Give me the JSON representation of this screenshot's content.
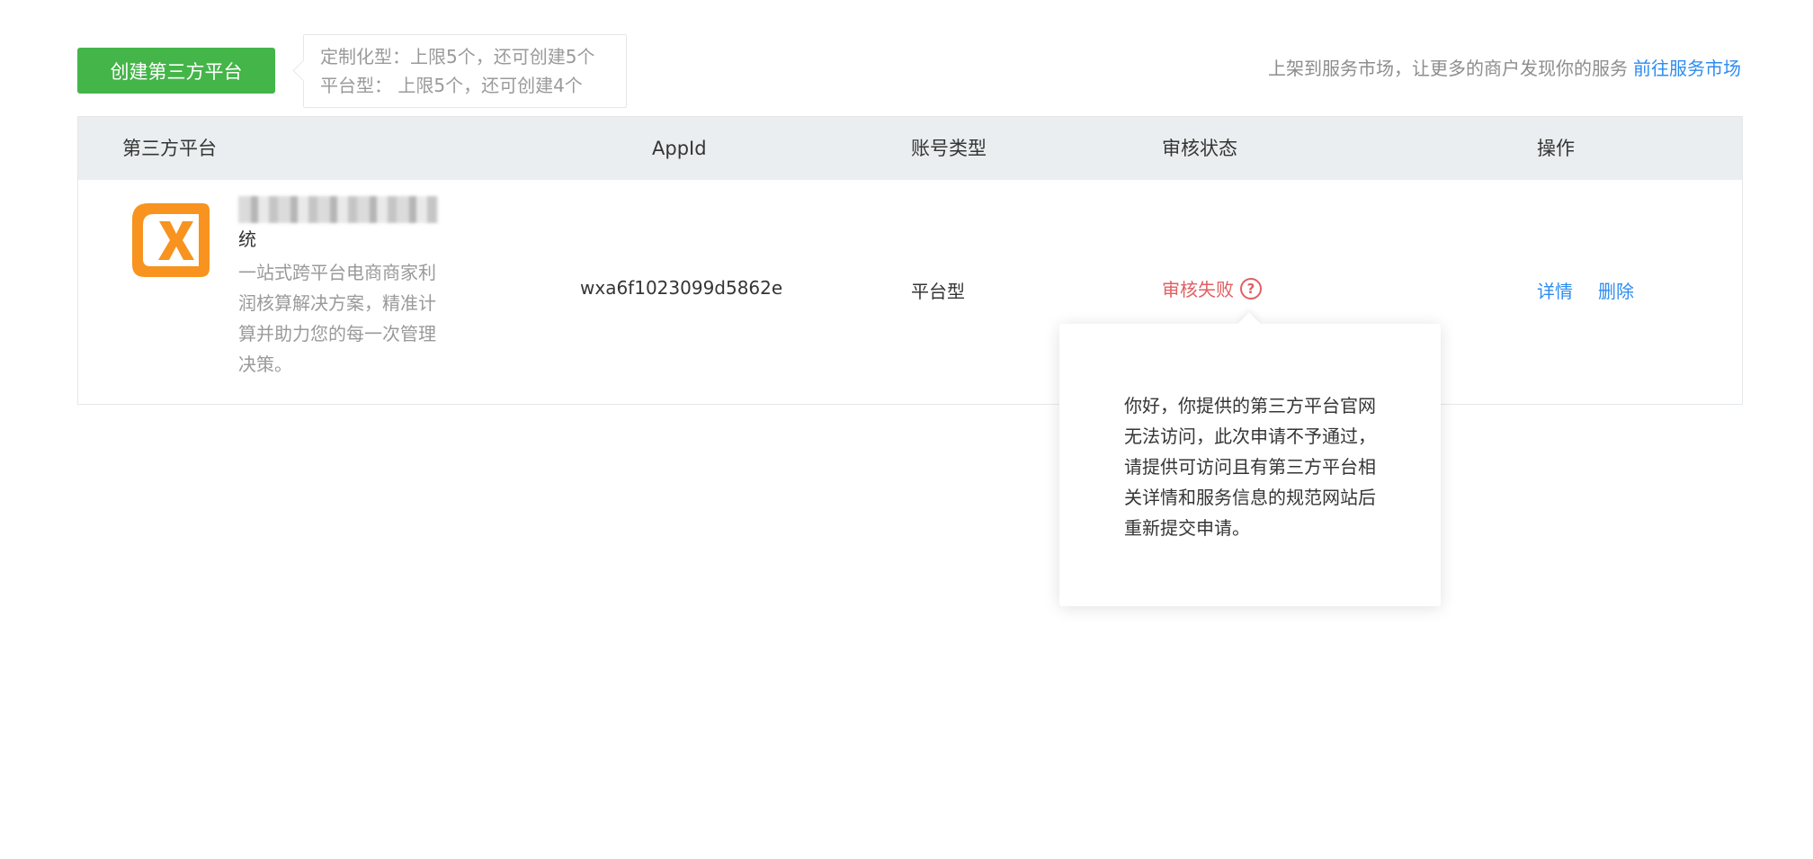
{
  "toolbar": {
    "create_button": "创建第三方平台",
    "quota_custom": "定制化型：上限5个，还可创建5个",
    "quota_platform": "平台型： 上限5个，还可创建4个",
    "market_tip": "上架到服务市场，让更多的商户发现你的服务",
    "market_link": "前往服务市场"
  },
  "table": {
    "headers": {
      "platform": "第三方平台",
      "appid": "AppId",
      "type": "账号类型",
      "status": "审核状态",
      "op": "操作"
    },
    "rows": [
      {
        "name_tail": "统",
        "description": "一站式跨平台电商商家利润核算解决方案，精准计算并助力您的每一次管理决策。",
        "appid": "wxa6f1023099d5862e",
        "type": "平台型",
        "status": "审核失败",
        "help_icon": "?",
        "op_detail": "详情",
        "op_delete": "删除"
      }
    ]
  },
  "popover": {
    "message": "你好，你提供的第三方平台官网无法访问，此次申请不予通过，请提供可访问且有第三方平台相关详情和服务信息的规范网站后重新提交申请。"
  },
  "colors": {
    "primary_green": "#44b549",
    "link_blue": "#2d8cf0",
    "error_red": "#e15f63",
    "header_bg": "#ebeef0",
    "logo_orange": "#f7931e"
  },
  "icons": {
    "logo": "x-logo-icon",
    "help": "question-circle-icon"
  }
}
